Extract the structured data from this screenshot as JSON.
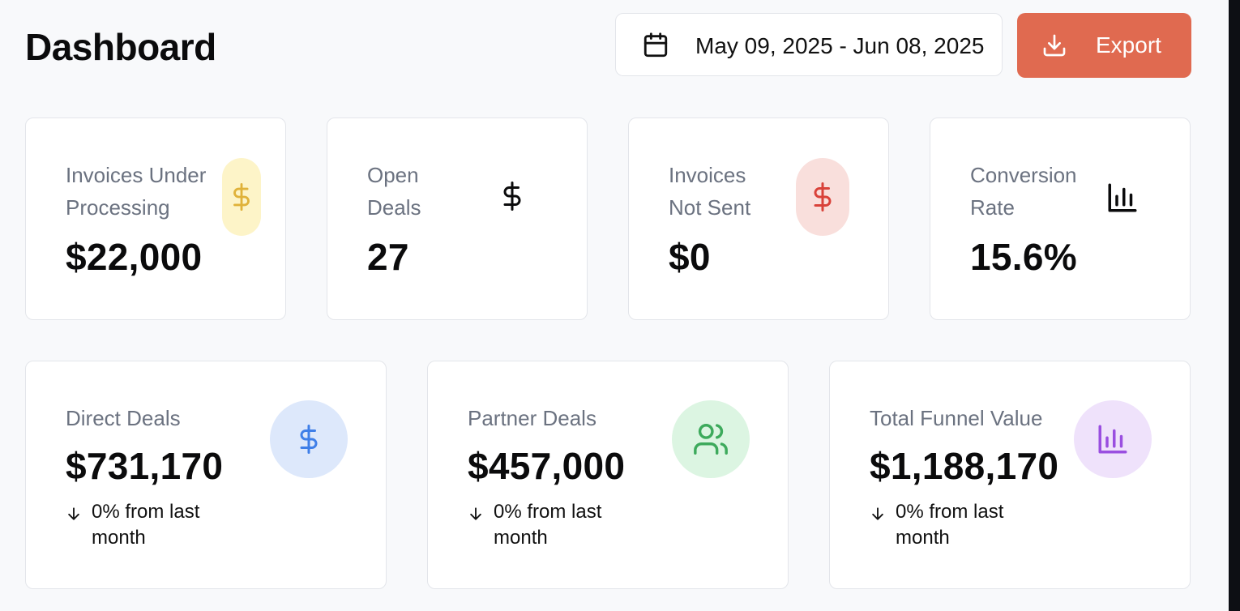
{
  "header": {
    "title": "Dashboard",
    "date_range": "May 09, 2025 - Jun 08, 2025",
    "export_label": "Export"
  },
  "kpis": [
    {
      "label": "Invoices Under\nProcessing",
      "value": "$22,000",
      "icon": "dollar-icon",
      "icon_color": "#e0b23a",
      "icon_bg": "#fdf4c8"
    },
    {
      "label": "Open\nDeals",
      "value": "27",
      "icon": "dollar-icon",
      "icon_color": "#0b0b0c",
      "icon_bg": ""
    },
    {
      "label": "Invoices\nNot Sent",
      "value": "$0",
      "icon": "dollar-icon",
      "icon_color": "#d9423a",
      "icon_bg": "#f9dfdc"
    },
    {
      "label": "Conversion\nRate",
      "value": "15.6%",
      "icon": "bar-chart-icon",
      "icon_color": "#0b0b0c",
      "icon_bg": ""
    }
  ],
  "deal_cards": [
    {
      "label": "Direct Deals",
      "value": "$731,170",
      "trend": "0% from last month",
      "icon": "dollar-icon",
      "icon_color": "#3f7fe8",
      "icon_bg": "#dde8fb"
    },
    {
      "label": "Partner Deals",
      "value": "$457,000",
      "trend": "0% from last month",
      "icon": "users-icon",
      "icon_color": "#3daa5c",
      "icon_bg": "#dcf5e2"
    },
    {
      "label": "Total Funnel Value",
      "value": "$1,188,170",
      "trend": "0% from last month",
      "icon": "bar-chart-icon",
      "icon_color": "#9a4fe0",
      "icon_bg": "#efe2fb"
    }
  ]
}
